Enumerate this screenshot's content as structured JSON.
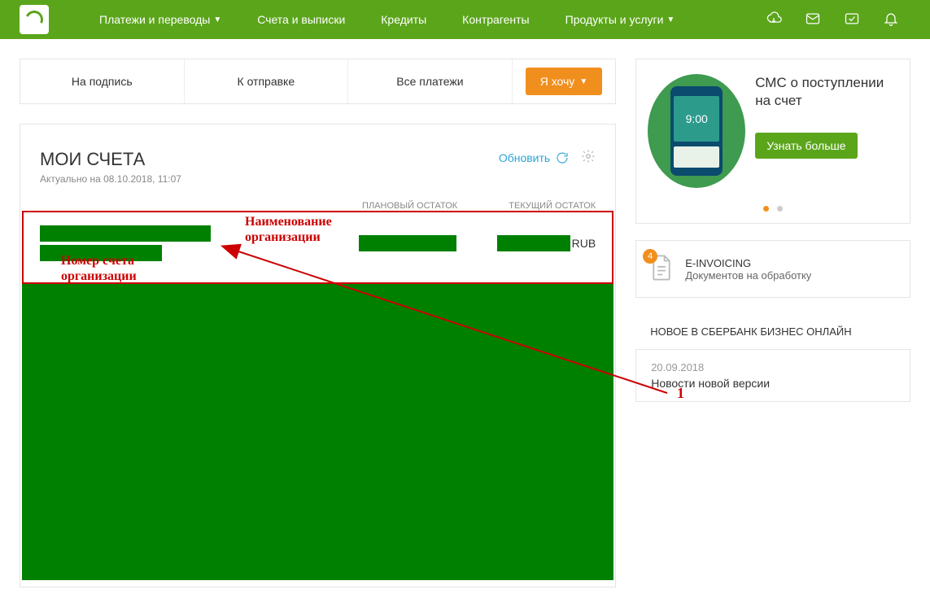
{
  "nav": {
    "items": [
      {
        "label": "Платежи и переводы",
        "dropdown": true
      },
      {
        "label": "Счета и выписки",
        "dropdown": false
      },
      {
        "label": "Кредиты",
        "dropdown": false
      },
      {
        "label": "Контрагенты",
        "dropdown": false
      },
      {
        "label": "Продукты и услуги",
        "dropdown": true
      }
    ]
  },
  "tabs": {
    "t1": "На подпись",
    "t2": "К отправке",
    "t3": "Все платежи",
    "action": "Я хочу"
  },
  "accounts": {
    "title": "МОИ СЧЕТА",
    "subtitle": "Актуально на 08.10.2018, 11:07",
    "refresh": "Обновить",
    "col_planned": "ПЛАНОВЫЙ ОСТАТОК",
    "col_current": "ТЕКУЩИЙ ОСТАТОК",
    "currency": "RUB"
  },
  "annotations": {
    "org_name": "Наименование\nорганизации",
    "acc_num": "Номер счета\nорганизации",
    "arrow_label": "1"
  },
  "promo": {
    "title": "СМС о поступлении на счет",
    "phone_time": "9:00",
    "button": "Узнать больше"
  },
  "einvoicing": {
    "badge": "4",
    "title": "E-INVOICING",
    "subtitle": "Документов на обработку"
  },
  "news": {
    "heading": "НОВОЕ В СБЕРБАНК БИЗНЕС ОНЛАЙН",
    "items": [
      {
        "date": "20.09.2018",
        "title": "Новости новой версии"
      }
    ]
  }
}
